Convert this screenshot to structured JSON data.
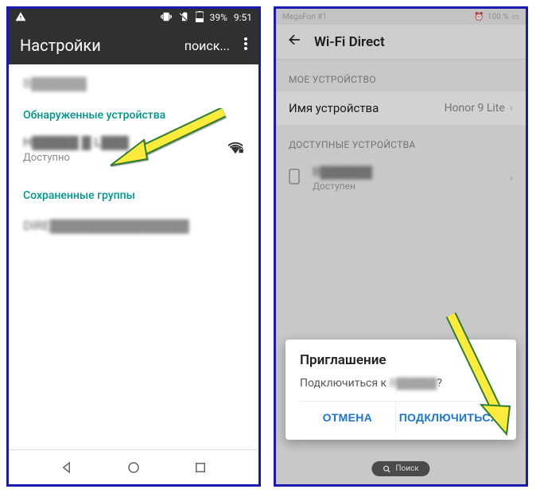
{
  "left": {
    "status": {
      "battery": "39%",
      "time": "9:51"
    },
    "appbar": {
      "title": "Настройки",
      "search": "поиск..."
    },
    "my_device_blur": "B▓▓▓▓▓▓",
    "section_found": "Обнаруженные устройства",
    "device": {
      "name_blur": "H▓▓▓▓▓ ▓ L▓▓▓",
      "status": "Доступно"
    },
    "section_saved": "Сохраненные группы",
    "saved_blur": "DIRE▓▓▓▓▓▓▓▓▓▓▓▓▓▓▓"
  },
  "right": {
    "status": {
      "carrier": "MegaFon #1",
      "battery": "100 %"
    },
    "titlebar": "Wi-Fi Direct",
    "section_my": "МОЕ УСТРОЙСТВО",
    "device_label": "Имя устройства",
    "device_value": "Honor 9 Lite",
    "section_avail": "ДОСТУПНЫЕ УСТРОЙСТВА",
    "avail": {
      "name_blur": "B▓▓▓▓▓▓",
      "status": "Доступен"
    },
    "dialog": {
      "title": "Приглашение",
      "text_prefix": "Подключиться к ",
      "text_blur": "B▓▓▓▓▓",
      "text_suffix": "?",
      "cancel": "ОТМЕНА",
      "connect": "ПОДКЛЮЧИТЬСЯ"
    },
    "search_pill": "Поиск"
  }
}
